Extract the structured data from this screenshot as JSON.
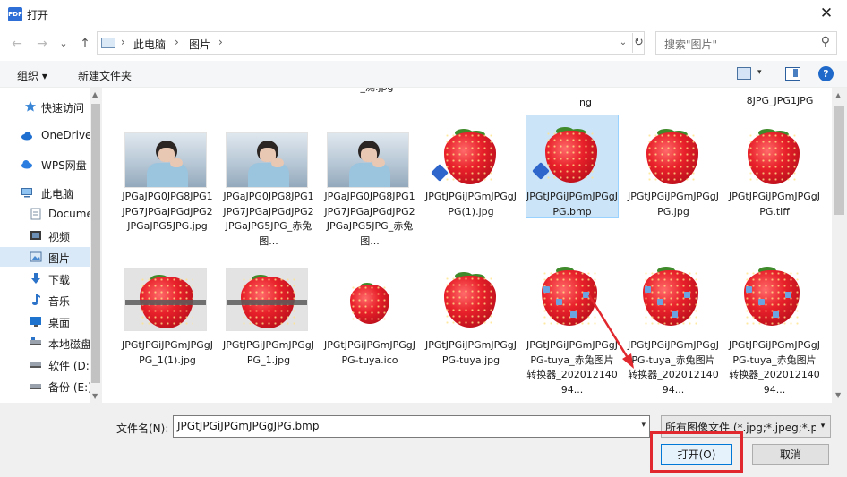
{
  "window": {
    "app_icon_text": "PDF",
    "title": "打开",
    "close_glyph": "✕"
  },
  "nav": {
    "back": "←",
    "forward": "→",
    "recent_dropdown": "⌄",
    "up": "↑"
  },
  "address": {
    "crumbs": [
      "此电脑",
      "图片"
    ],
    "separator": "›",
    "dropdown": "⌄",
    "refresh": "↻"
  },
  "search": {
    "placeholder": "搜索\"图片\"",
    "icon": "⚲"
  },
  "toolbar": {
    "organize": "组织 ▾",
    "new_folder": "新建文件夹",
    "view_dropdown": "▾",
    "help": "?"
  },
  "sidebar": {
    "items": [
      {
        "label": "快速访问",
        "icon": "star-icon",
        "selected": false
      },
      {
        "label": "OneDrive",
        "icon": "cloud-icon",
        "selected": false
      },
      {
        "label": "WPS网盘",
        "icon": "wps-cloud-icon",
        "selected": false
      },
      {
        "label": "此电脑",
        "icon": "computer-icon",
        "selected": false
      },
      {
        "label": "Docume",
        "icon": "documents-icon",
        "selected": false
      },
      {
        "label": "视频",
        "icon": "video-icon",
        "selected": false
      },
      {
        "label": "图片",
        "icon": "pictures-icon",
        "selected": true
      },
      {
        "label": "下载",
        "icon": "download-icon",
        "selected": false
      },
      {
        "label": "音乐",
        "icon": "music-icon",
        "selected": false
      },
      {
        "label": "桌面",
        "icon": "desktop-icon",
        "selected": false
      },
      {
        "label": "本地磁盘",
        "icon": "drive-icon",
        "selected": false
      },
      {
        "label": "软件 (D:",
        "icon": "drive-icon",
        "selected": false
      },
      {
        "label": "备份 (E:)",
        "icon": "drive-icon",
        "selected": false
      }
    ]
  },
  "files": {
    "row0": [
      {
        "name": "_测.jpg"
      },
      {
        "name": "ng"
      },
      {
        "name": "8JPG_JPG1JPG"
      }
    ],
    "row1": [
      {
        "name": "JPGaJPG0JPG8JPG1JPG7JPGaJPGdJPG2JPGaJPG5JPG.jpg",
        "thumb": "photo"
      },
      {
        "name": "JPGaJPG0JPG8JPG1JPG7JPGaJPGdJPG2JPGaJPG5JPG_赤兔图...",
        "thumb": "photo"
      },
      {
        "name": "JPGaJPG0JPG8JPG1JPG7JPGaJPGdJPG2JPGaJPG5JPG_赤兔图...",
        "thumb": "photo"
      },
      {
        "name": "JPGtJPGiJPGmJPGgJPG(1).jpg",
        "thumb": "berry-badge"
      },
      {
        "name": "JPGtJPGiJPGmJPGgJPG.bmp",
        "thumb": "berry-badge",
        "selected": true
      },
      {
        "name": "JPGtJPGiJPGmJPGgJPG.jpg",
        "thumb": "berry"
      },
      {
        "name": "JPGtJPGiJPGmJPGgJPG.tiff",
        "thumb": "berry"
      }
    ],
    "row2": [
      {
        "name": "JPGtJPGiJPGmJPGgJPG_1(1).jpg",
        "thumb": "berry-grey"
      },
      {
        "name": "JPGtJPGiJPGmJPGgJPG_1.jpg",
        "thumb": "berry-grey"
      },
      {
        "name": "JPGtJPGiJPGmJPGgJPG-tuya.ico",
        "thumb": "berry-small"
      },
      {
        "name": "JPGtJPGiJPGmJPGgJPG-tuya.jpg",
        "thumb": "berry"
      },
      {
        "name": "JPGtJPGiJPGmJPGgJPG-tuya_赤兔图片转换器_20201214094...",
        "thumb": "berry-wm"
      },
      {
        "name": "JPGtJPGiJPGmJPGgJPG-tuya_赤兔图片转换器_20201214094...",
        "thumb": "berry-wm"
      },
      {
        "name": "JPGtJPGiJPGmJPGgJPG-tuya_赤兔图片转换器_20201214094...",
        "thumb": "berry-wm"
      }
    ]
  },
  "bottom": {
    "filename_label": "文件名(N):",
    "filename_value": "JPGtJPGiJPGmJPGgJPG.bmp",
    "filter_value": "所有图像文件 (*.jpg;*.jpeg;*.p",
    "open_button": "打开(O)",
    "cancel_button": "取消"
  },
  "colors": {
    "accent": "#0078d7",
    "selection": "#cce4f7",
    "highlight_red": "#e0282e"
  }
}
